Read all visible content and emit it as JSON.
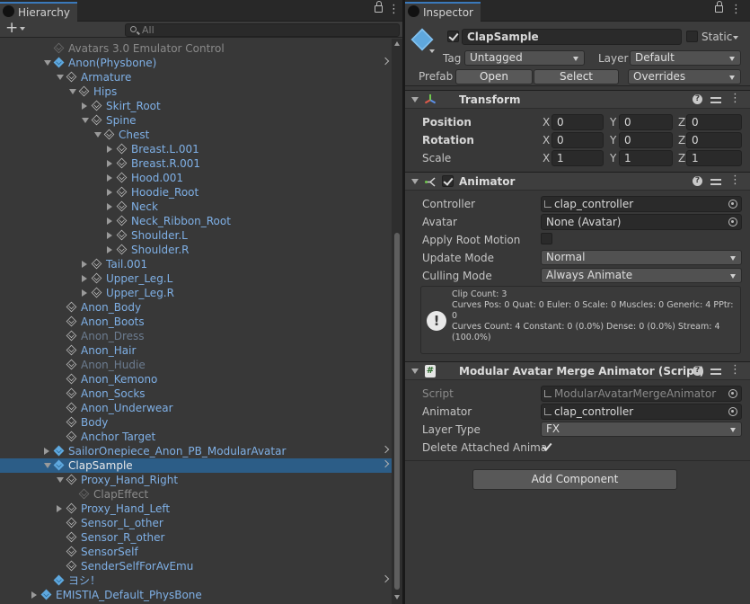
{
  "hierarchy": {
    "tab_label": "Hierarchy",
    "search_placeholder": "All",
    "rows": [
      {
        "label": "Avatars 3.0 Emulator Control",
        "style": "grey"
      },
      {
        "label": "Anon(Physbone)",
        "style": "blue"
      },
      {
        "label": "Armature",
        "style": "blue"
      },
      {
        "label": "Hips",
        "style": "blue"
      },
      {
        "label": "Skirt_Root",
        "style": "blue"
      },
      {
        "label": "Spine",
        "style": "blue"
      },
      {
        "label": "Chest",
        "style": "blue"
      },
      {
        "label": "Breast.L.001",
        "style": "blue"
      },
      {
        "label": "Breast.R.001",
        "style": "blue"
      },
      {
        "label": "Hood.001",
        "style": "blue"
      },
      {
        "label": "Hoodie_Root",
        "style": "blue"
      },
      {
        "label": "Neck",
        "style": "blue"
      },
      {
        "label": "Neck_Ribbon_Root",
        "style": "blue"
      },
      {
        "label": "Shoulder.L",
        "style": "blue"
      },
      {
        "label": "Shoulder.R",
        "style": "blue"
      },
      {
        "label": "Tail.001",
        "style": "blue"
      },
      {
        "label": "Upper_Leg.L",
        "style": "blue"
      },
      {
        "label": "Upper_Leg.R",
        "style": "blue"
      },
      {
        "label": "Anon_Body",
        "style": "blue"
      },
      {
        "label": "Anon_Boots",
        "style": "blue"
      },
      {
        "label": "Anon_Dress",
        "style": "dim"
      },
      {
        "label": "Anon_Hair",
        "style": "blue"
      },
      {
        "label": "Anon_Hudie",
        "style": "dim"
      },
      {
        "label": "Anon_Kemono",
        "style": "blue"
      },
      {
        "label": "Anon_Socks",
        "style": "blue"
      },
      {
        "label": "Anon_Underwear",
        "style": "blue"
      },
      {
        "label": "Body",
        "style": "blue"
      },
      {
        "label": "Anchor Target",
        "style": "blue"
      },
      {
        "label": "SailorOnepiece_Anon_PB_ModularAvatar",
        "style": "blue"
      },
      {
        "label": "ClapSample",
        "style": "white"
      },
      {
        "label": "Proxy_Hand_Right",
        "style": "blue"
      },
      {
        "label": "ClapEffect",
        "style": "grey"
      },
      {
        "label": "Proxy_Hand_Left",
        "style": "blue"
      },
      {
        "label": "Sensor_L_other",
        "style": "blue"
      },
      {
        "label": "Sensor_R_other",
        "style": "blue"
      },
      {
        "label": "SensorSelf",
        "style": "blue"
      },
      {
        "label": "SenderSelfForAvEmu",
        "style": "blue"
      },
      {
        "label": "ヨシ！",
        "style": "blue"
      },
      {
        "label": "EMISTIA_Default_PhysBone",
        "style": "blue"
      }
    ]
  },
  "inspector": {
    "tab_label": "Inspector",
    "object_name": "ClapSample",
    "static_label": "Static",
    "tag_label": "Tag",
    "tag_value": "Untagged",
    "layer_label": "Layer",
    "layer_value": "Default",
    "prefab_label": "Prefab",
    "open_label": "Open",
    "select_label": "Select",
    "overrides_label": "Overrides",
    "transform": {
      "title": "Transform",
      "position_label": "Position",
      "rotation_label": "Rotation",
      "scale_label": "Scale",
      "x": "X",
      "y": "Y",
      "z": "Z",
      "position": [
        "0",
        "0",
        "0"
      ],
      "rotation": [
        "0",
        "0",
        "0"
      ],
      "scale": [
        "1",
        "1",
        "1"
      ]
    },
    "animator": {
      "title": "Animator",
      "controller_label": "Controller",
      "controller_value": "clap_controller",
      "avatar_label": "Avatar",
      "avatar_value": "None (Avatar)",
      "apply_root_motion_label": "Apply Root Motion",
      "update_mode_label": "Update Mode",
      "update_mode_value": "Normal",
      "culling_mode_label": "Culling Mode",
      "culling_mode_value": "Always Animate",
      "info_text": "Clip Count: 3\nCurves Pos: 0 Quat: 0 Euler: 0 Scale: 0 Muscles: 0 Generic: 4 PPtr: 0\nCurves Count: 4 Constant: 0 (0.0%) Dense: 0 (0.0%) Stream: 4 (100.0%)"
    },
    "merge_animator": {
      "title": "Modular Avatar Merge Animator (Script)",
      "script_label": "Script",
      "script_value": "ModularAvatarMergeAnimator",
      "animator_label": "Animator",
      "animator_value": "clap_controller",
      "layer_type_label": "Layer Type",
      "layer_type_value": "FX",
      "delete_attached_label": "Delete Attached Anima"
    },
    "add_component_label": "Add Component"
  }
}
